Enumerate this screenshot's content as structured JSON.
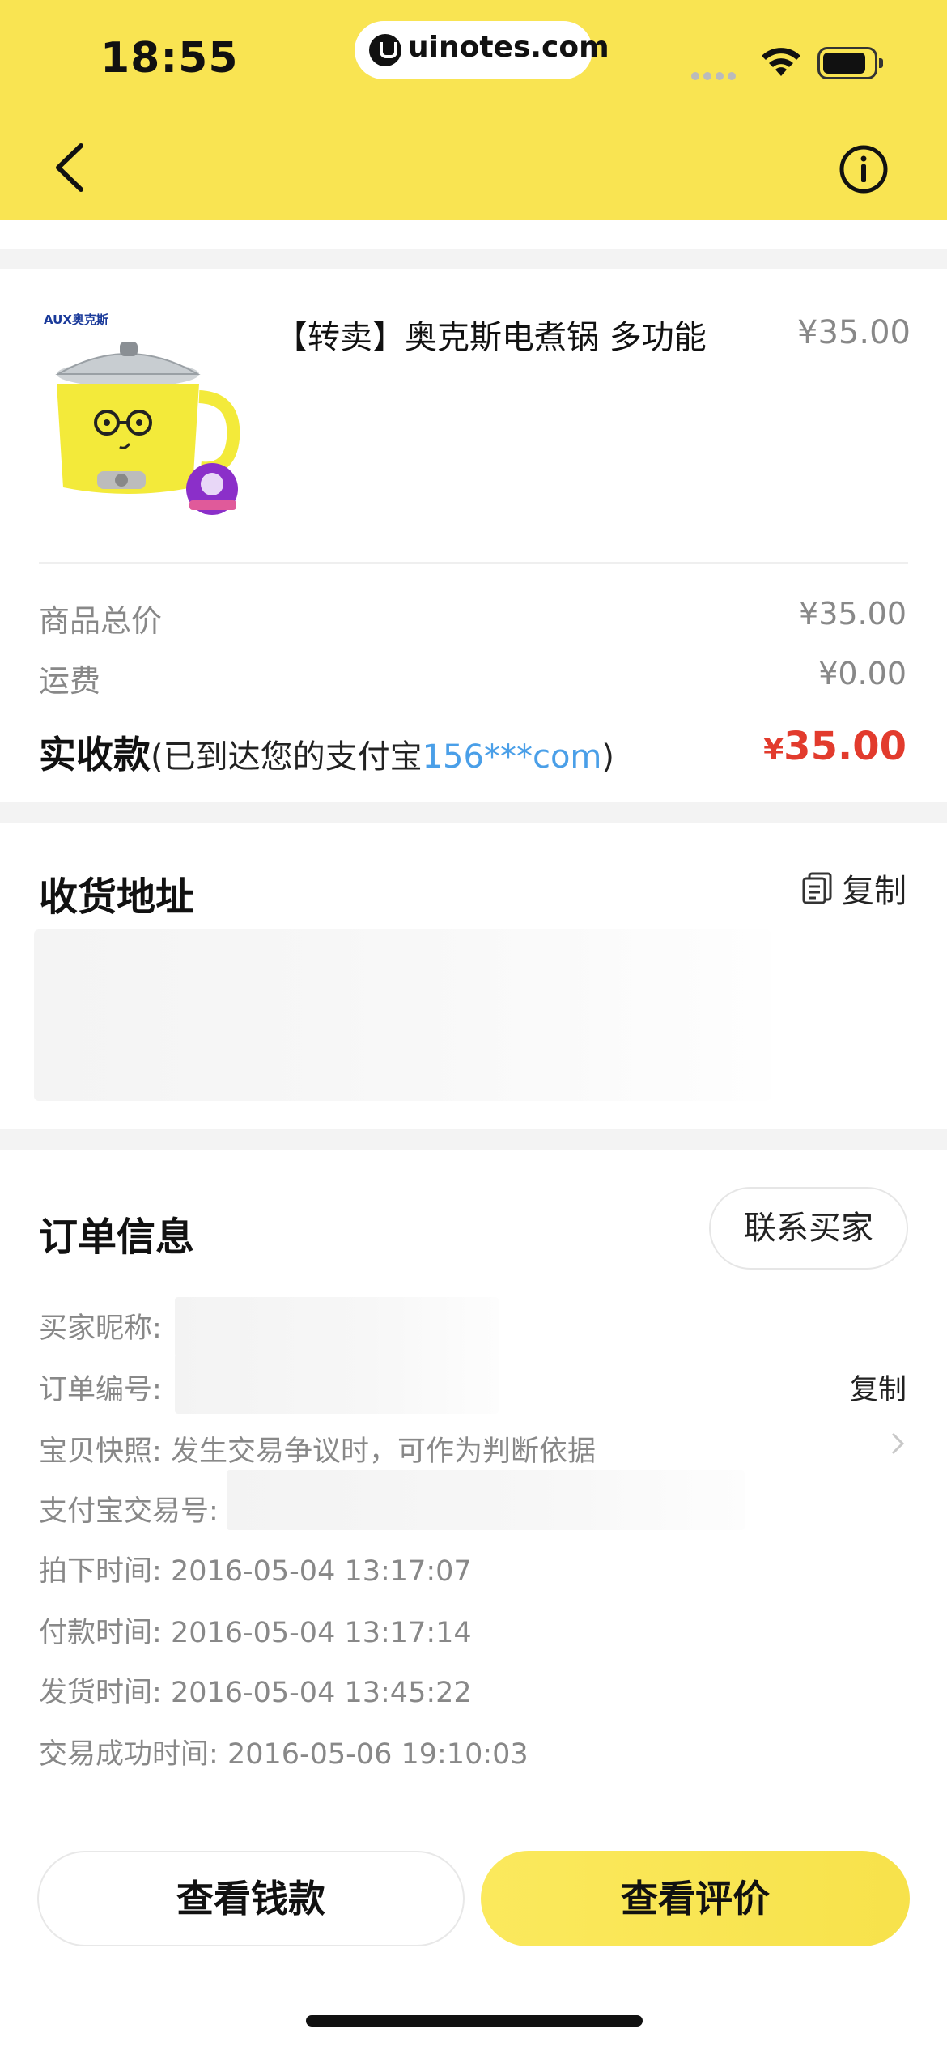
{
  "status_bar": {
    "time": "18:55",
    "url": "uinotes.com"
  },
  "product": {
    "title": "【转卖】奥克斯电煮锅 多功能",
    "price": "¥35.00",
    "brand_logo_text": "AUX奥克斯"
  },
  "pricing": {
    "total_label": "商品总价",
    "total_value": "¥35.00",
    "shipping_label": "运费",
    "shipping_value": "¥0.00",
    "actual_label": "实收款",
    "actual_note_prefix": "(已到达您的支付宝",
    "actual_account": "156***com",
    "actual_note_suffix": ")",
    "actual_currency": "¥",
    "actual_amount": "35.00"
  },
  "address": {
    "title": "收货地址",
    "copy_label": "复制"
  },
  "order": {
    "title": "订单信息",
    "contact_label": "联系买家",
    "buyer_nick_label": "买家昵称:",
    "order_no_label": "订单编号:",
    "order_copy_label": "复制",
    "snapshot_label": "宝贝快照:",
    "snapshot_value": "发生交易争议时，可作为判断依据",
    "alipay_trade_label": "支付宝交易号:",
    "placed_label": "拍下时间:",
    "placed_value": "2016-05-04 13:17:07",
    "paid_label": "付款时间:",
    "paid_value": "2016-05-04 13:17:14",
    "shipped_label": "发货时间:",
    "shipped_value": "2016-05-04 13:45:22",
    "success_label": "交易成功时间:",
    "success_value": "2016-05-06 19:10:03"
  },
  "actions": {
    "view_money": "查看钱款",
    "view_review": "查看评价"
  },
  "colors": {
    "header_yellow": "#f9e452",
    "price_red": "#e23b2d",
    "link_blue": "#4a9fe8"
  }
}
